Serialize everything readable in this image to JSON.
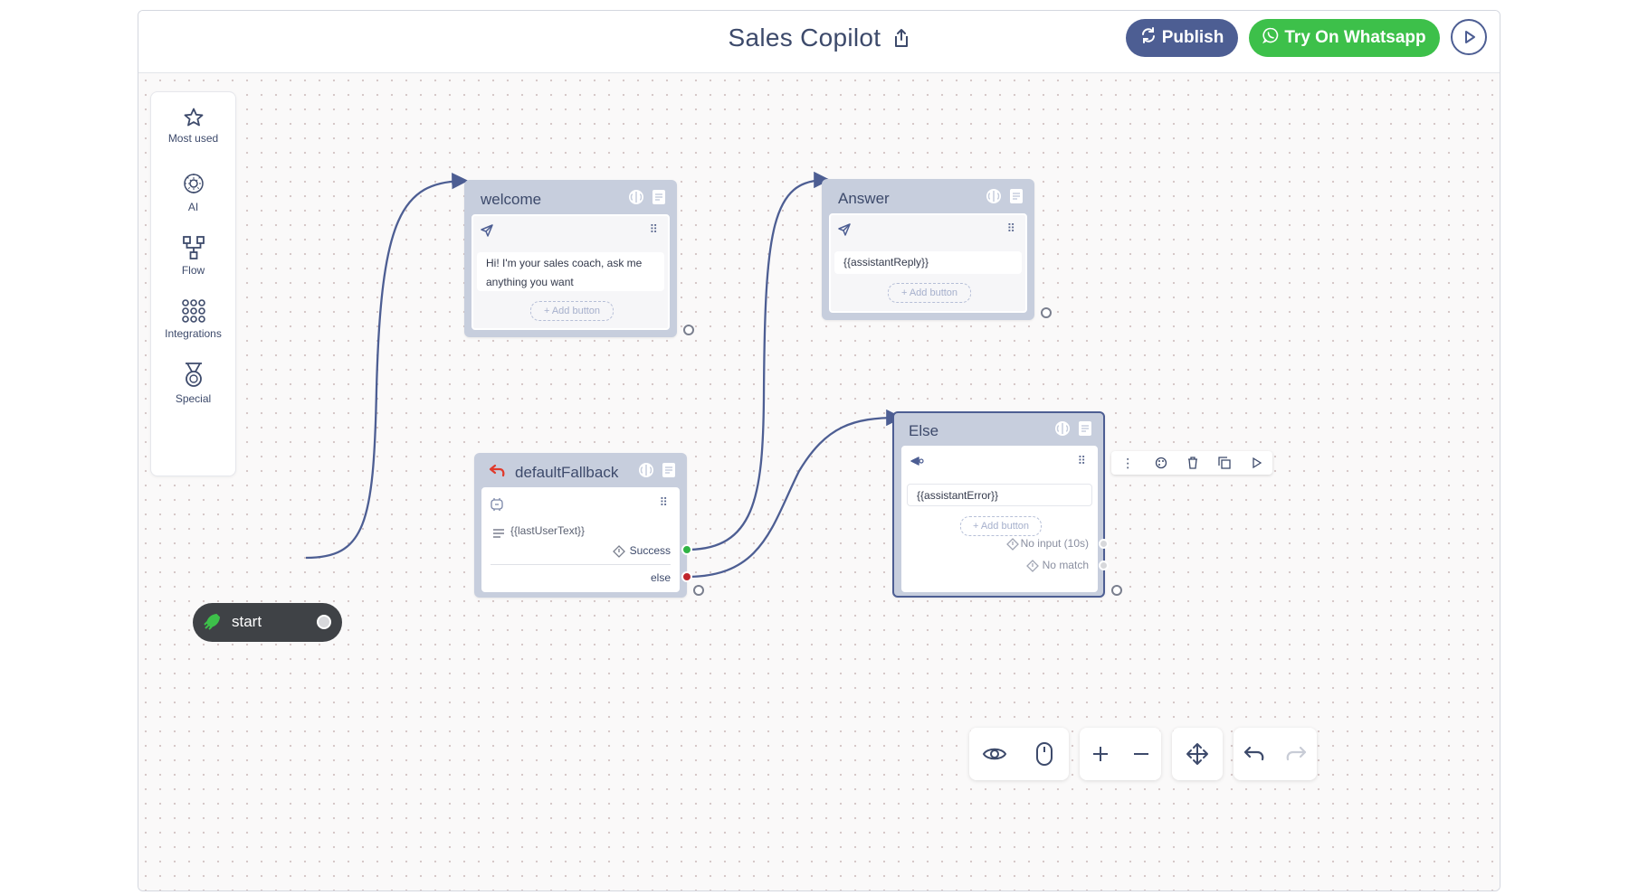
{
  "header": {
    "title": "Sales Copilot",
    "publish_label": "Publish",
    "whatsapp_label": "Try On Whatsapp"
  },
  "palette": {
    "items": [
      {
        "label": "Most used",
        "icon": "star-icon"
      },
      {
        "label": "AI",
        "icon": "ai-brain-icon"
      },
      {
        "label": "Flow",
        "icon": "flow-icon"
      },
      {
        "label": "Integrations",
        "icon": "integrations-grid-icon"
      },
      {
        "label": "Special",
        "icon": "medal-icon"
      }
    ]
  },
  "nodes": {
    "start": {
      "label": "start"
    },
    "welcome": {
      "title": "welcome",
      "message": "Hi! I'm your sales coach, ask me anything you want",
      "add_button": "+ Add button"
    },
    "answer": {
      "title": "Answer",
      "message": "{{assistantReply}}",
      "add_button": "+ Add button"
    },
    "fallback": {
      "title": "defaultFallback",
      "text": "{{lastUserText}}",
      "success": "Success",
      "else": "else"
    },
    "else_node": {
      "title": "Else",
      "message": "{{assistantError}}",
      "add_button": "+ Add button",
      "no_input": "No input (10s)",
      "no_match": "No match"
    }
  },
  "colors": {
    "primary": "#4d5e93",
    "whatsapp": "#3dc04a",
    "node_bg": "#c7cedd",
    "success_dot": "#2fb344",
    "else_dot": "#c0262d",
    "fallback_icon": "#e0392b"
  }
}
